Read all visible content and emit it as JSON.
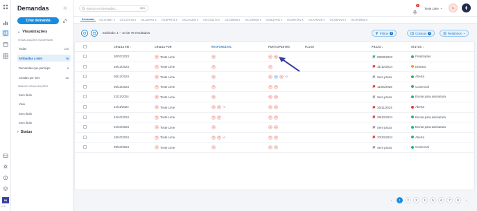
{
  "colors": {
    "accent": "#1a8ce0",
    "status_finalizada": "#2bb673",
    "status_distrato": "#f0a21b",
    "status_aberta": "#2bb673",
    "status_comercial": "#2bb673",
    "status_assinatura": "#2bb673",
    "flag_green": "#2bb673",
    "flag_red": "#e23b3b",
    "flag_gray": "#9aa0ad"
  },
  "rail": {
    "icons": [
      "grid-icon",
      "bar-chart-icon",
      "kanban-icon",
      "calendar-icon",
      "table-icon",
      "inbox-icon",
      "settings-icon",
      "money-icon",
      "layers-icon"
    ],
    "brand_label": "IN",
    "version": "v1.0"
  },
  "sidebar": {
    "title": "Demandas",
    "create_label": "Criar demanda",
    "views_section": "Visualizações",
    "suggested_label": "VISUALIZAÇÕES SUGERIDAS",
    "suggested": [
      {
        "label": "Todas",
        "count": "225"
      },
      {
        "label": "Atribuídas a mim",
        "count": "78"
      },
      {
        "label": "Demandas que participo",
        "count": "8"
      },
      {
        "label": "Criadas por mim",
        "count": "66"
      }
    ],
    "mine_label": "MINHAS VISUALIZAÇÕES",
    "mine": [
      {
        "label": "Sem título"
      },
      {
        "label": "View"
      },
      {
        "label": "Sem título"
      },
      {
        "label": "Sem título"
      }
    ],
    "status_section": "Status"
  },
  "topbar": {
    "search_placeholder": "Buscar em demandas...",
    "search_shortcut": "⌘ K",
    "notifications_count": "9",
    "user_name": "Teste Lime",
    "avatar_initials": "TL"
  },
  "tabs": [
    {
      "label": "Demandas",
      "active": true
    },
    {
      "label": "OS-47ZN5T",
      "active": false
    },
    {
      "label": "OS-CZTSYA",
      "active": false
    },
    {
      "label": "OS-AI4YKI1",
      "active": false
    },
    {
      "label": "OS-8PPKTA",
      "active": false
    },
    {
      "label": "OS-OV4Z5K",
      "active": false
    },
    {
      "label": "OS-CSUZTS",
      "active": false
    },
    {
      "label": "OS-549BVA",
      "active": false
    },
    {
      "label": "OS-C9B9Q9",
      "active": false
    },
    {
      "label": "OS-BQVF4Z",
      "active": false
    },
    {
      "label": "OS-8RYZRV",
      "active": false
    },
    {
      "label": "OS-XFKRZR",
      "active": false
    },
    {
      "label": "OS-N8YEVX",
      "active": false
    },
    {
      "label": "OS-RV5RQ8",
      "active": false
    }
  ],
  "toolbar": {
    "showing": "Exibindo: 1 – 10 de 78 resultados",
    "filters_label": "Filtros",
    "filters_count": "1",
    "columns_label": "Colunas",
    "columns_count": "0",
    "reports_label": "Relatórios"
  },
  "table": {
    "headers": {
      "created_at": "CRIADA EM",
      "created_by": "CRIADA POR",
      "responsible": "RESPONSÁVEL",
      "participants": "PARTICIPANTES",
      "flow": "FLUXO",
      "deadline": "PRAZO",
      "status": "STATUS"
    },
    "rows": [
      {
        "created_at": "30/07/2023",
        "created_by": "Teste Lime",
        "resp": [
          "TL"
        ],
        "parts": [
          "TL",
          "TL"
        ],
        "parts_more": "",
        "deadline": "08/08/2023",
        "deadline_flag": "green",
        "status": "Finalizadas",
        "status_color": "#2bb673"
      },
      {
        "created_at": "26/12/2024",
        "created_by": "Teste Lime",
        "resp": [
          "TL"
        ],
        "parts": [
          "TL"
        ],
        "parts_more": "",
        "deadline": "31/12/2024",
        "deadline_flag": "red",
        "status": "Distrato",
        "status_color": "#f0a21b"
      },
      {
        "created_at": "06/12/2024",
        "created_by": "Teste Lime",
        "resp": [
          "TL"
        ],
        "parts": [
          "TL",
          "TU",
          "TL"
        ],
        "parts_more": "+2",
        "deadline": "Sem prazo",
        "deadline_flag": "gray",
        "status": "Aberta",
        "status_color": "#2bb673"
      },
      {
        "created_at": "06/12/2024",
        "created_by": "Teste Lime",
        "resp": [
          "TL"
        ],
        "parts": [
          "TL",
          "LT"
        ],
        "parts_more": "",
        "deadline": "11/04/2025",
        "deadline_flag": "red",
        "status": "Comercial",
        "status_color": "#2bb673"
      },
      {
        "created_at": "22/11/2024",
        "created_by": "Teste Lime",
        "resp": [
          "TL"
        ],
        "parts": [
          "TL",
          "LT"
        ],
        "parts_more": "",
        "deadline": "Sem prazo",
        "deadline_flag": "gray",
        "status": "Enviar para assinatura",
        "status_color": "#2bb673"
      },
      {
        "created_at": "21/11/2024",
        "created_by": "Teste Lime",
        "resp": [
          "TL",
          "LT"
        ],
        "resp_more": "+3",
        "parts": [
          "TL",
          "LT"
        ],
        "parts_more": "",
        "deadline": "26/11/2024",
        "deadline_flag": "red",
        "status": "Aberta",
        "status_color": "#e23b3b"
      },
      {
        "created_at": "24/10/2024",
        "created_by": "Teste Lime",
        "resp": [
          "TL",
          "LT"
        ],
        "parts": [
          "TL",
          "LT"
        ],
        "parts_more": "",
        "deadline": "29/10/2024",
        "deadline_flag": "red",
        "status": "Enviar para assinatura",
        "status_color": "#2bb673"
      },
      {
        "created_at": "24/10/2024",
        "created_by": "Teste Lime",
        "resp": [
          "TL"
        ],
        "parts": [
          "TL",
          "LT"
        ],
        "parts_more": "",
        "deadline": "Sem prazo",
        "deadline_flag": "gray",
        "status": "Enviar para assinatura",
        "status_color": "#2bb673"
      },
      {
        "created_at": "18/10/2024",
        "created_by": "Teste Lime",
        "resp": [
          "TL",
          "LT"
        ],
        "resp_more": "+3",
        "parts": [
          "TL",
          "LT"
        ],
        "parts_more": "",
        "deadline": "23/10/2024",
        "deadline_flag": "red",
        "status": "Aberta",
        "status_color": "#2bb673"
      },
      {
        "created_at": "09/10/2024",
        "created_by": "Teste Lime",
        "resp": [
          "TL"
        ],
        "parts": [
          "LT",
          "TT"
        ],
        "parts_more": "",
        "deadline": "Sem prazo",
        "deadline_flag": "gray",
        "status": "Comercial",
        "status_color": "#2bb673"
      }
    ]
  },
  "pagination": {
    "pages": [
      "1",
      "2",
      "3",
      "4",
      "5",
      "6",
      "7",
      "8"
    ],
    "current": "1",
    "prev": "‹",
    "next": "›"
  }
}
